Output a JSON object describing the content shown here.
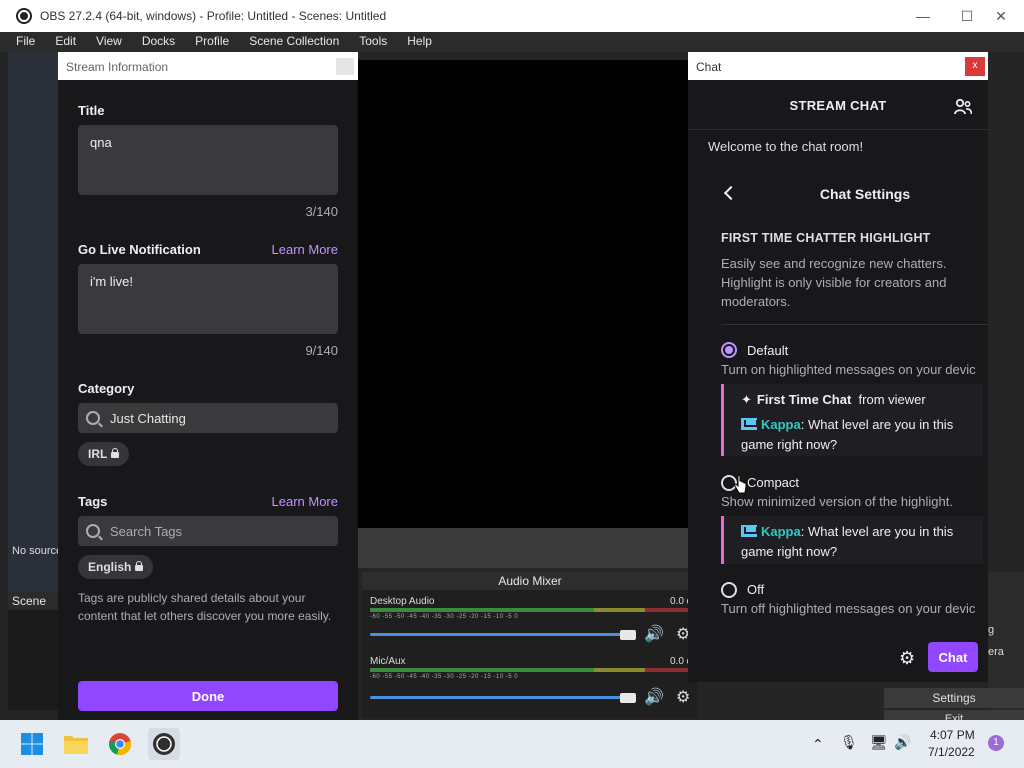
{
  "obs": {
    "title": "OBS 27.2.4 (64-bit, windows) - Profile: Untitled - Scenes: Untitled",
    "menu": [
      "File",
      "Edit",
      "View",
      "Docks",
      "Profile",
      "Scene Collection",
      "Tools",
      "Help"
    ],
    "no_source": "No source",
    "scene_header": "Scene",
    "mixer_title": "Audio Mixer",
    "tracks": [
      {
        "name": "Desktop Audio",
        "db": "0.0 d"
      },
      {
        "name": "Mic/Aux",
        "db": "0.0 d"
      }
    ],
    "meter_ticks": "-60 -55 -50 -45 -40 -35 -30 -25 -20 -15 -10 -5 0",
    "right_tabs": [
      "g",
      "era"
    ],
    "settings_button": "Settings",
    "exit_button": "Exit"
  },
  "stream_info": {
    "window_title": "Stream Information",
    "title_label": "Title",
    "title_value": "qna",
    "title_count": "3/140",
    "golive_label": "Go Live Notification",
    "learn_more": "Learn More",
    "golive_value": "i'm live!",
    "golive_count": "9/140",
    "category_label": "Category",
    "category_value": "Just Chatting",
    "category_tag": "IRL",
    "tags_label": "Tags",
    "tags_learn_more": "Learn More",
    "tags_placeholder": "Search Tags",
    "tag_english": "English",
    "tags_desc": "Tags are publicly shared details about your content that let others discover you more easily.",
    "done_button": "Done"
  },
  "chat": {
    "window_title": "Chat",
    "close_label": "x",
    "header": "STREAM CHAT",
    "welcome": "Welcome to the chat room!",
    "settings_title": "Chat Settings",
    "section_title": "FIRST TIME CHATTER HIGHLIGHT",
    "section_desc": "Easily see and recognize new chatters. Highlight is only visible for creators and moderators.",
    "options": [
      {
        "label": "Default",
        "desc": "Turn on highlighted messages on your devic",
        "selected": true
      },
      {
        "label": "Compact",
        "desc": "Show minimized version of the highlight.",
        "selected": false
      },
      {
        "label": "Off",
        "desc": "Turn off highlighted messages on your devic",
        "selected": false
      }
    ],
    "ftc_title": "First Time Chat",
    "ftc_from": "from viewer",
    "sample_user": "Kappa",
    "sample_msg": ": What level are you in this game right now?",
    "chat_button": "Chat"
  },
  "taskbar": {
    "time": "4:07 PM",
    "date": "7/1/2022",
    "notifications": "1"
  },
  "colors": {
    "twitch_purple": "#9147ff",
    "link_purple": "#bf94ff",
    "highlight_pink": "#e86bd5"
  }
}
